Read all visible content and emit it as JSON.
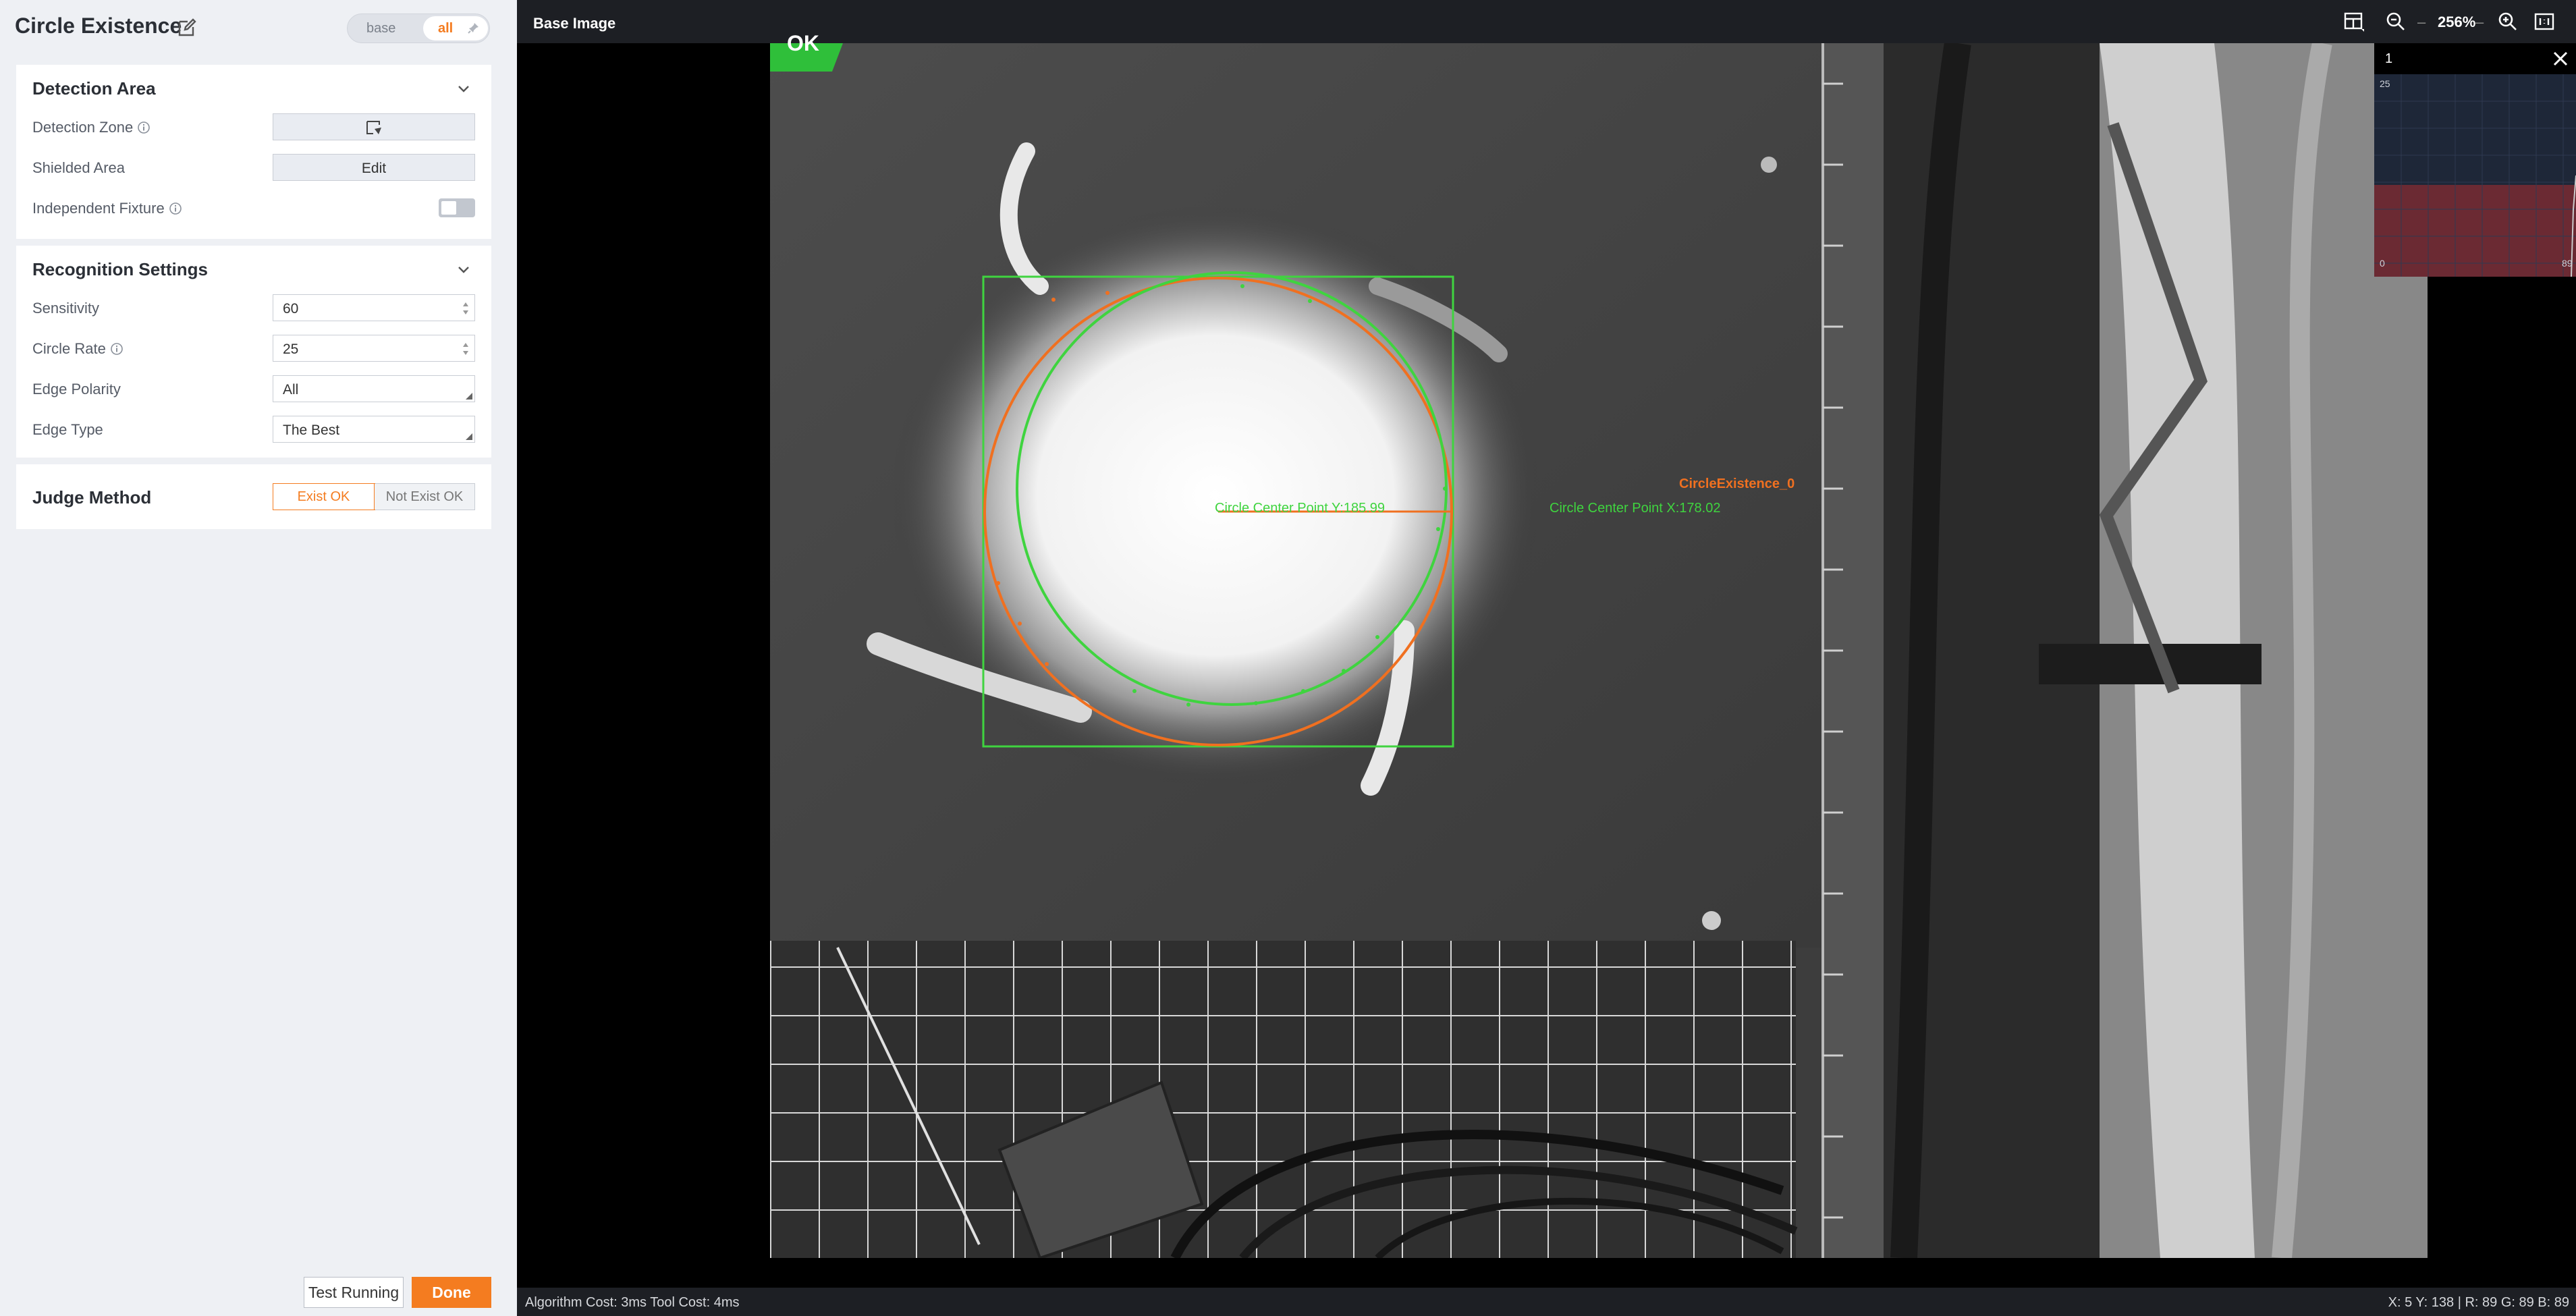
{
  "header": {
    "title": "Circle Existence",
    "toggle": {
      "base_label": "base",
      "all_label": "all",
      "selected": "all"
    }
  },
  "detection_area": {
    "title": "Detection Area",
    "detection_zone_label": "Detection Zone",
    "shielded_area_label": "Shielded Area",
    "shielded_area_button": "Edit",
    "independent_fixture_label": "Independent Fixture",
    "independent_fixture_on": false
  },
  "recognition": {
    "title": "Recognition Settings",
    "sensitivity_label": "Sensitivity",
    "sensitivity_value": "60",
    "circle_rate_label": "Circle Rate",
    "circle_rate_value": "25",
    "edge_polarity_label": "Edge Polarity",
    "edge_polarity_value": "All",
    "edge_type_label": "Edge Type",
    "edge_type_value": "The Best"
  },
  "judge": {
    "title": "Judge Method",
    "option_a": "Exist OK",
    "option_b": "Not Exist OK",
    "selected": "Exist OK"
  },
  "footer": {
    "test_button": "Test Running",
    "done_button": "Done"
  },
  "viewer": {
    "title": "Base Image",
    "zoom": "256%",
    "zoom_sep": "–",
    "result_badge": "OK",
    "overlay_name": "CircleExistence_0",
    "overlay_center_x": "Circle Center Point X:178.02",
    "overlay_center_y": "Circle Center Point Y:185.99",
    "histogram": {
      "channel": "1",
      "y_max": "25",
      "x_min": "0",
      "x_max": "89"
    },
    "status_left": "Algorithm Cost: 3ms Tool Cost: 4ms",
    "status_right": "X: 5 Y: 138 | R: 89 G: 89 B: 89"
  },
  "colors": {
    "accent": "#f47c20",
    "detect_green": "#3fd43f",
    "fit_orange": "#f07020"
  }
}
